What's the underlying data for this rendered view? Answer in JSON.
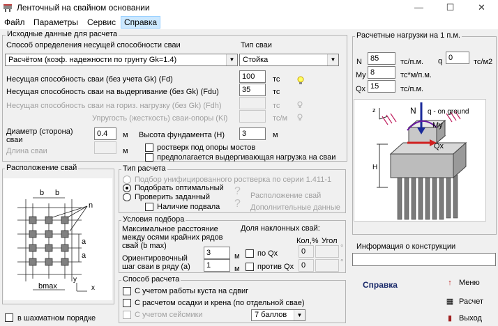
{
  "window": {
    "title": "Ленточный на свайном основании"
  },
  "menu": [
    "Файл",
    "Параметры",
    "Сервис",
    "Справка"
  ],
  "initial": {
    "legend": "Исходные данные для расчета",
    "method_label": "Способ определения несущей способности сваи",
    "method_value": "Расчётом  (коэф. надежности по грунту Gk=1.4)",
    "pile_type_label": "Тип сваи",
    "pile_type_value": "Стойка",
    "fd_label": "Несущая способность сваи (без учета Gk)  (Fd)",
    "fd_value": "100",
    "fdu_label": "Несущая способность сваи на выдергивание (без Gk)  (Fdu)",
    "fdu_value": "35",
    "fdh_label": "Несущая способность сваи на гориз. нагрузку (без Gk)  (Fdh)",
    "ki_label": "Упругость (жесткость) сваи-опоры (Ki)",
    "unit_tc": "тс",
    "unit_tcm": "тс/м",
    "diam_label": "Диаметр (сторона) сваи",
    "diam_value": "0.4",
    "unit_m": "м",
    "pile_len_label": "Длина сваи",
    "height_label": "Высота фундамента (H)",
    "height_value": "3",
    "bridge_label": "ростверк под опоры мостов",
    "pullout_label": "предполагается выдергивающая нагрузка на сваи"
  },
  "loads": {
    "legend": "Расчетные нагрузки на 1 п.м.",
    "n_label": "N",
    "n_value": "85",
    "n_unit": "тс/п.м.",
    "q_label": "q",
    "q_value": "0",
    "q_unit": "тс/м2",
    "my_label": "My",
    "my_value": "8",
    "my_unit": "тс*м/п.м.",
    "qx_label": "Qx",
    "qx_value": "15",
    "qx_unit": "тс/п.м.",
    "img_q": "q - on ground",
    "img_n": "N",
    "img_my": "My",
    "img_qx": "Qx",
    "img_h": "H"
  },
  "layout": {
    "legend": "Расположение свай",
    "b": "b",
    "a": "a",
    "n": "n",
    "bmax": "bmax",
    "y": "y",
    "x": "x",
    "checker_label": "в шахматном порядке"
  },
  "calc_type": {
    "legend": "Тип расчета",
    "opt1": "Подбор унифицированного ростверка по серии 1.411-1",
    "opt2": "Подобрать оптимальный",
    "opt3": "Проверить заданный",
    "basement": "Наличие подвала",
    "layout_link": "Расположение свай",
    "extra_link": "Дополнительные данные"
  },
  "selection": {
    "legend": "Условия подбора",
    "max_dist": "Максимальное расстояние между осями крайних рядов свай (b max)",
    "max_dist_value": "3",
    "step_label": "Ориентировочный шаг сваи в ряду (a)",
    "step_value": "1",
    "inclined": "Доля наклонных свай:",
    "col_count": "Кол,%",
    "col_angle": "Угол",
    "by_qx": "по Qx",
    "against_qx": "против Qx",
    "val_zero": "0",
    "unit_m": "м",
    "deg": "°"
  },
  "method": {
    "legend": "Способ расчета",
    "opt1": "С учетом работы куста на сдвиг",
    "opt2": "С расчетом осадки и крена (по отдельной свае)",
    "opt3": "С учетом сейсмики",
    "seismic_value": "7 баллов"
  },
  "info": {
    "label": "Информация о конструкции"
  },
  "buttons": {
    "help": "Справка",
    "menu": "Меню",
    "calc": "Расчет",
    "exit": "Выход"
  }
}
